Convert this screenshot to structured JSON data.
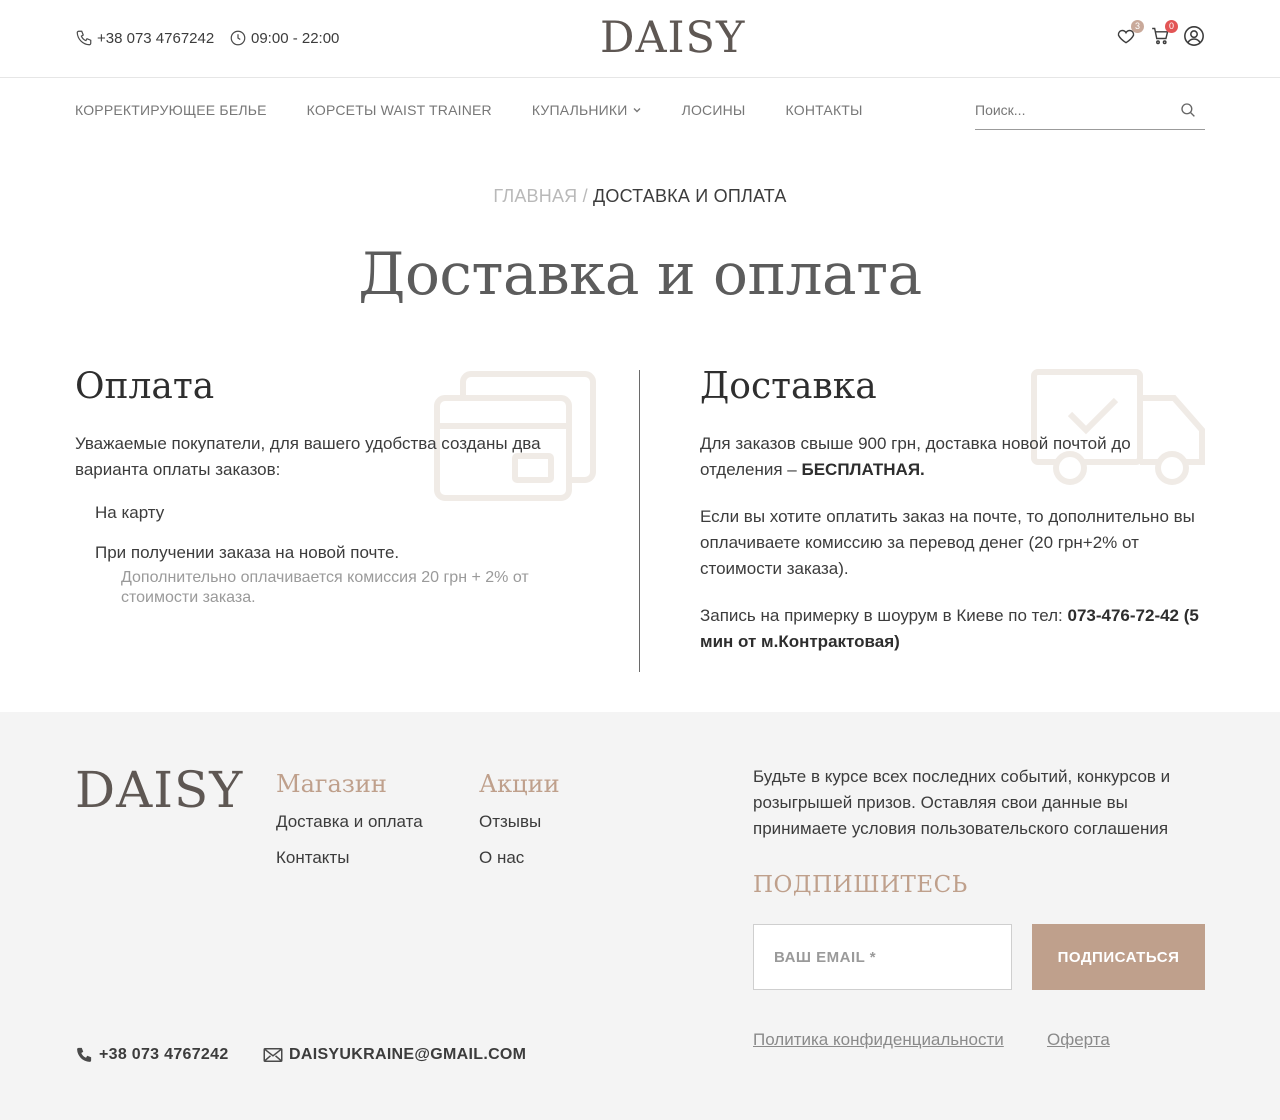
{
  "header": {
    "phone": "+38 073 4767242",
    "hours": "09:00 - 22:00",
    "logo": "DAISY",
    "favorites_count": "3",
    "cart_count": "0"
  },
  "nav": {
    "items": [
      {
        "label": "КОРРЕКТИРУЮЩЕЕ БЕЛЬЕ"
      },
      {
        "label": "КОРСЕТЫ WAIST TRAINER"
      },
      {
        "label": "КУПАЛЬНИКИ"
      },
      {
        "label": "ЛОСИНЫ"
      },
      {
        "label": "КОНТАКТЫ"
      }
    ],
    "search_placeholder": "Поиск..."
  },
  "breadcrumb": {
    "home": "ГЛАВНАЯ",
    "separator": "/",
    "current": "ДОСТАВКА И ОПЛАТА"
  },
  "page_title": "Доставка и оплата",
  "payment": {
    "title": "Оплата",
    "intro": "Уважаемые покупатели, для вашего удобства созданы два варианта оплаты заказов:",
    "option1": "На карту",
    "option2": "При получении заказа на новой почте.",
    "option2_note": "Дополнительно оплачивается комиссия 20 грн + 2% от стоимости заказа."
  },
  "delivery": {
    "title": "Доставка",
    "p1_text": "Для заказов свыше 900 грн, доставка новой почтой до отделения – ",
    "p1_bold": "БЕСПЛАТНАЯ.",
    "p2": "Если вы хотите оплатить заказ на почте, то дополнительно вы оплачиваете комиссию за перевод денег (20 грн+2% от стоимости заказа).",
    "p3_text": "Запись на примерку в шоурум в Киеве по тел: ",
    "p3_bold": "073-476-72-42 (5 мин от м.Контрактовая)"
  },
  "footer": {
    "logo": "DAISY",
    "shop": {
      "title": "Магазин",
      "links": [
        "Доставка и оплата",
        "Контакты"
      ]
    },
    "promo": {
      "title": "Акции",
      "links": [
        "Отзывы",
        "О нас"
      ]
    },
    "newsletter_text": "Будьте в курсе всех последних событий, конкурсов и розыгрышей призов. Оставляя свои данные вы принимаете условия пользовательского соглашения",
    "subscribe_title": "ПОДПИШИТЕСЬ",
    "email_placeholder": "ВАШ EMAIL *",
    "subscribe_button": "ПОДПИСАТЬСЯ",
    "privacy": "Политика конфиденциальности",
    "offer": "Оферта",
    "phone": "+38 073 4767242",
    "email": "DAISYUKRAINE@GMAIL.COM"
  },
  "colors": {
    "accent": "#bfa08c",
    "text": "#3c3c3c",
    "footer_bg": "#f4f4f4",
    "cart_badge": "#e25555"
  }
}
